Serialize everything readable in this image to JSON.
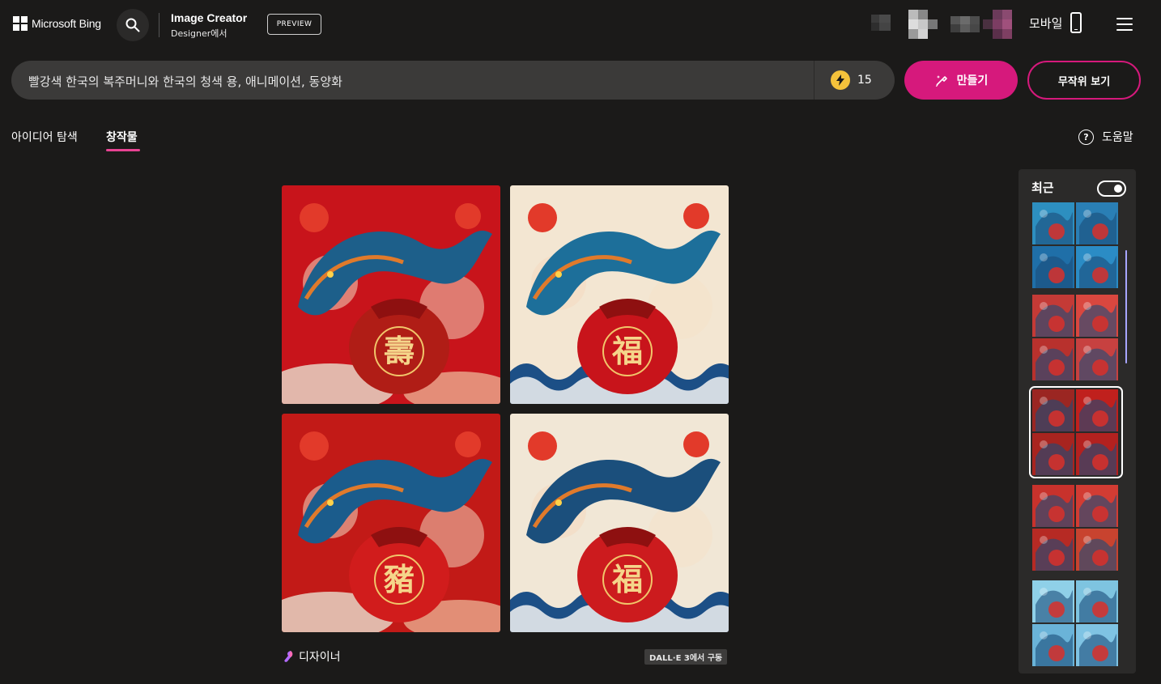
{
  "header": {
    "logo_text": "Microsoft Bing",
    "app_title": "Image Creator",
    "app_subtitle": "Designer에서",
    "preview_badge": "PREVIEW",
    "mobile_label": "모바일"
  },
  "prompt": {
    "text": "빨강색 한국의 복주머니와 한국의 청색 용, 애니메이션, 동양화",
    "boosts": "15"
  },
  "buttons": {
    "create": "만들기",
    "random": "무작위 보기"
  },
  "tabs": [
    {
      "label": "아이디어 탐색",
      "active": false
    },
    {
      "label": "창작물",
      "active": true
    }
  ],
  "help_label": "도움말",
  "result": {
    "designer_label": "디자이너",
    "model_badge": "DALL·E 3에서 구동",
    "images": [
      {
        "char": "壽",
        "bg": "#c8141b",
        "dragon": "#1d5f8a",
        "bag": "#b01d16"
      },
      {
        "char": "福",
        "bg": "#f3e6d2",
        "dragon": "#1d6f9a",
        "bag": "#c8141b"
      },
      {
        "char": "豬",
        "bg": "#c21a17",
        "dragon": "#1b5c8c",
        "bag": "#d11c1c"
      },
      {
        "char": "福",
        "bg": "#f1e7d6",
        "dragon": "#1b4f7c",
        "bag": "#cc1b1e"
      }
    ]
  },
  "recent": {
    "title": "최근",
    "toggle_on": true,
    "groups": [
      {
        "colors": [
          "#2d8fc0",
          "#2a7fb5",
          "#1f6fa8",
          "#2b8cc5"
        ],
        "selected": false
      },
      {
        "colors": [
          "#c43a36",
          "#d9473f",
          "#b8312d",
          "#c74140"
        ],
        "selected": false
      },
      {
        "colors": [
          "#9b2622",
          "#c0201d",
          "#a8241f",
          "#b3211f"
        ],
        "selected": true
      },
      {
        "colors": [
          "#c8322c",
          "#d23c33",
          "#b62a24",
          "#c8432f"
        ],
        "selected": false
      },
      {
        "colors": [
          "#8fd0e8",
          "#7ec4e0",
          "#6ab3d8",
          "#7fc3e3"
        ],
        "selected": false
      }
    ]
  }
}
